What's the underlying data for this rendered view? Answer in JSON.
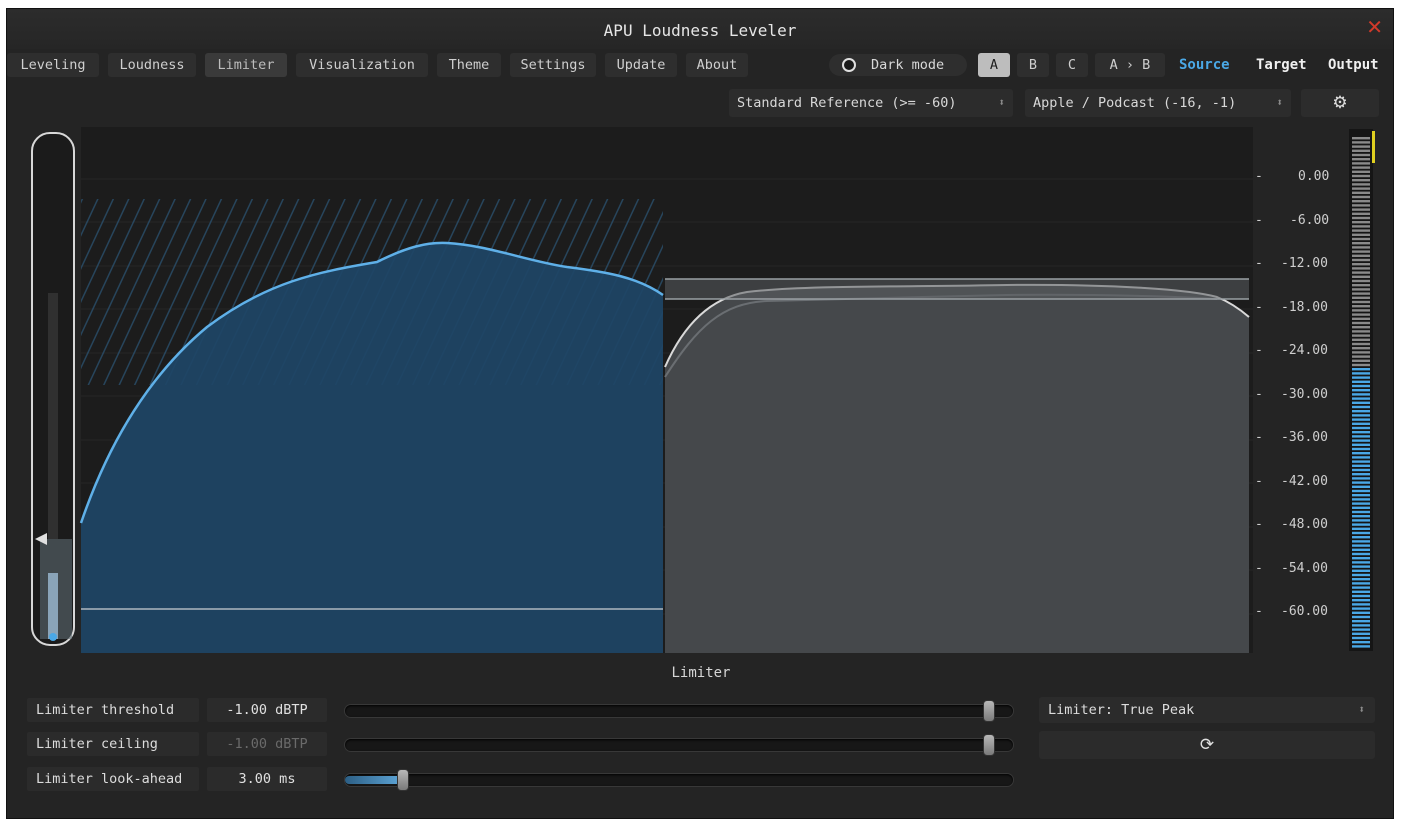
{
  "window": {
    "title": "APU Loudness Leveler",
    "close_glyph": "✕"
  },
  "tabs": [
    {
      "label": "Leveling"
    },
    {
      "label": "Loudness"
    },
    {
      "label": "Limiter",
      "active": true
    },
    {
      "label": "Visualization"
    },
    {
      "label": "Theme"
    },
    {
      "label": "Settings"
    },
    {
      "label": "Update"
    },
    {
      "label": "About"
    }
  ],
  "dark_mode": {
    "label": "Dark mode",
    "enabled": true
  },
  "ab": {
    "a": "A",
    "b": "B",
    "c": "C",
    "atob": "A › B",
    "selected": "A"
  },
  "views": {
    "source": "Source",
    "target": "Target",
    "output": "Output",
    "active": "Source"
  },
  "presets": {
    "reference": "Standard Reference (>= -60)",
    "target": "Apple / Podcast (-16, -1)",
    "arrow": "⬍",
    "settings_icon": "gear-icon"
  },
  "scale": {
    "labels": [
      "0.00",
      "-6.00",
      "-12.00",
      "-18.00",
      "-24.00",
      "-30.00",
      "-36.00",
      "-42.00",
      "-48.00",
      "-54.00",
      "-60.00"
    ],
    "tick": "-"
  },
  "colors": {
    "accent": "#4aa8e6",
    "source_fill": "#1e4566",
    "output_fill": "#4a4d50",
    "close": "#d23a2a",
    "peak_marker": "#e0d020"
  },
  "limiter": {
    "section_title": "Limiter",
    "threshold": {
      "label": "Limiter threshold",
      "value": "-1.00 dBTP",
      "level": 0.97
    },
    "ceiling": {
      "label": "Limiter ceiling",
      "value": "-1.00 dBTP",
      "level": 0.97,
      "disabled": true
    },
    "lookahead": {
      "label": "Limiter look-ahead",
      "value": "3.00 ms",
      "level": 0.09
    },
    "mode": "Limiter: True Peak",
    "mode_arrow": "⬍",
    "reset_icon": "refresh-icon",
    "reset_glyph": "⟳"
  }
}
